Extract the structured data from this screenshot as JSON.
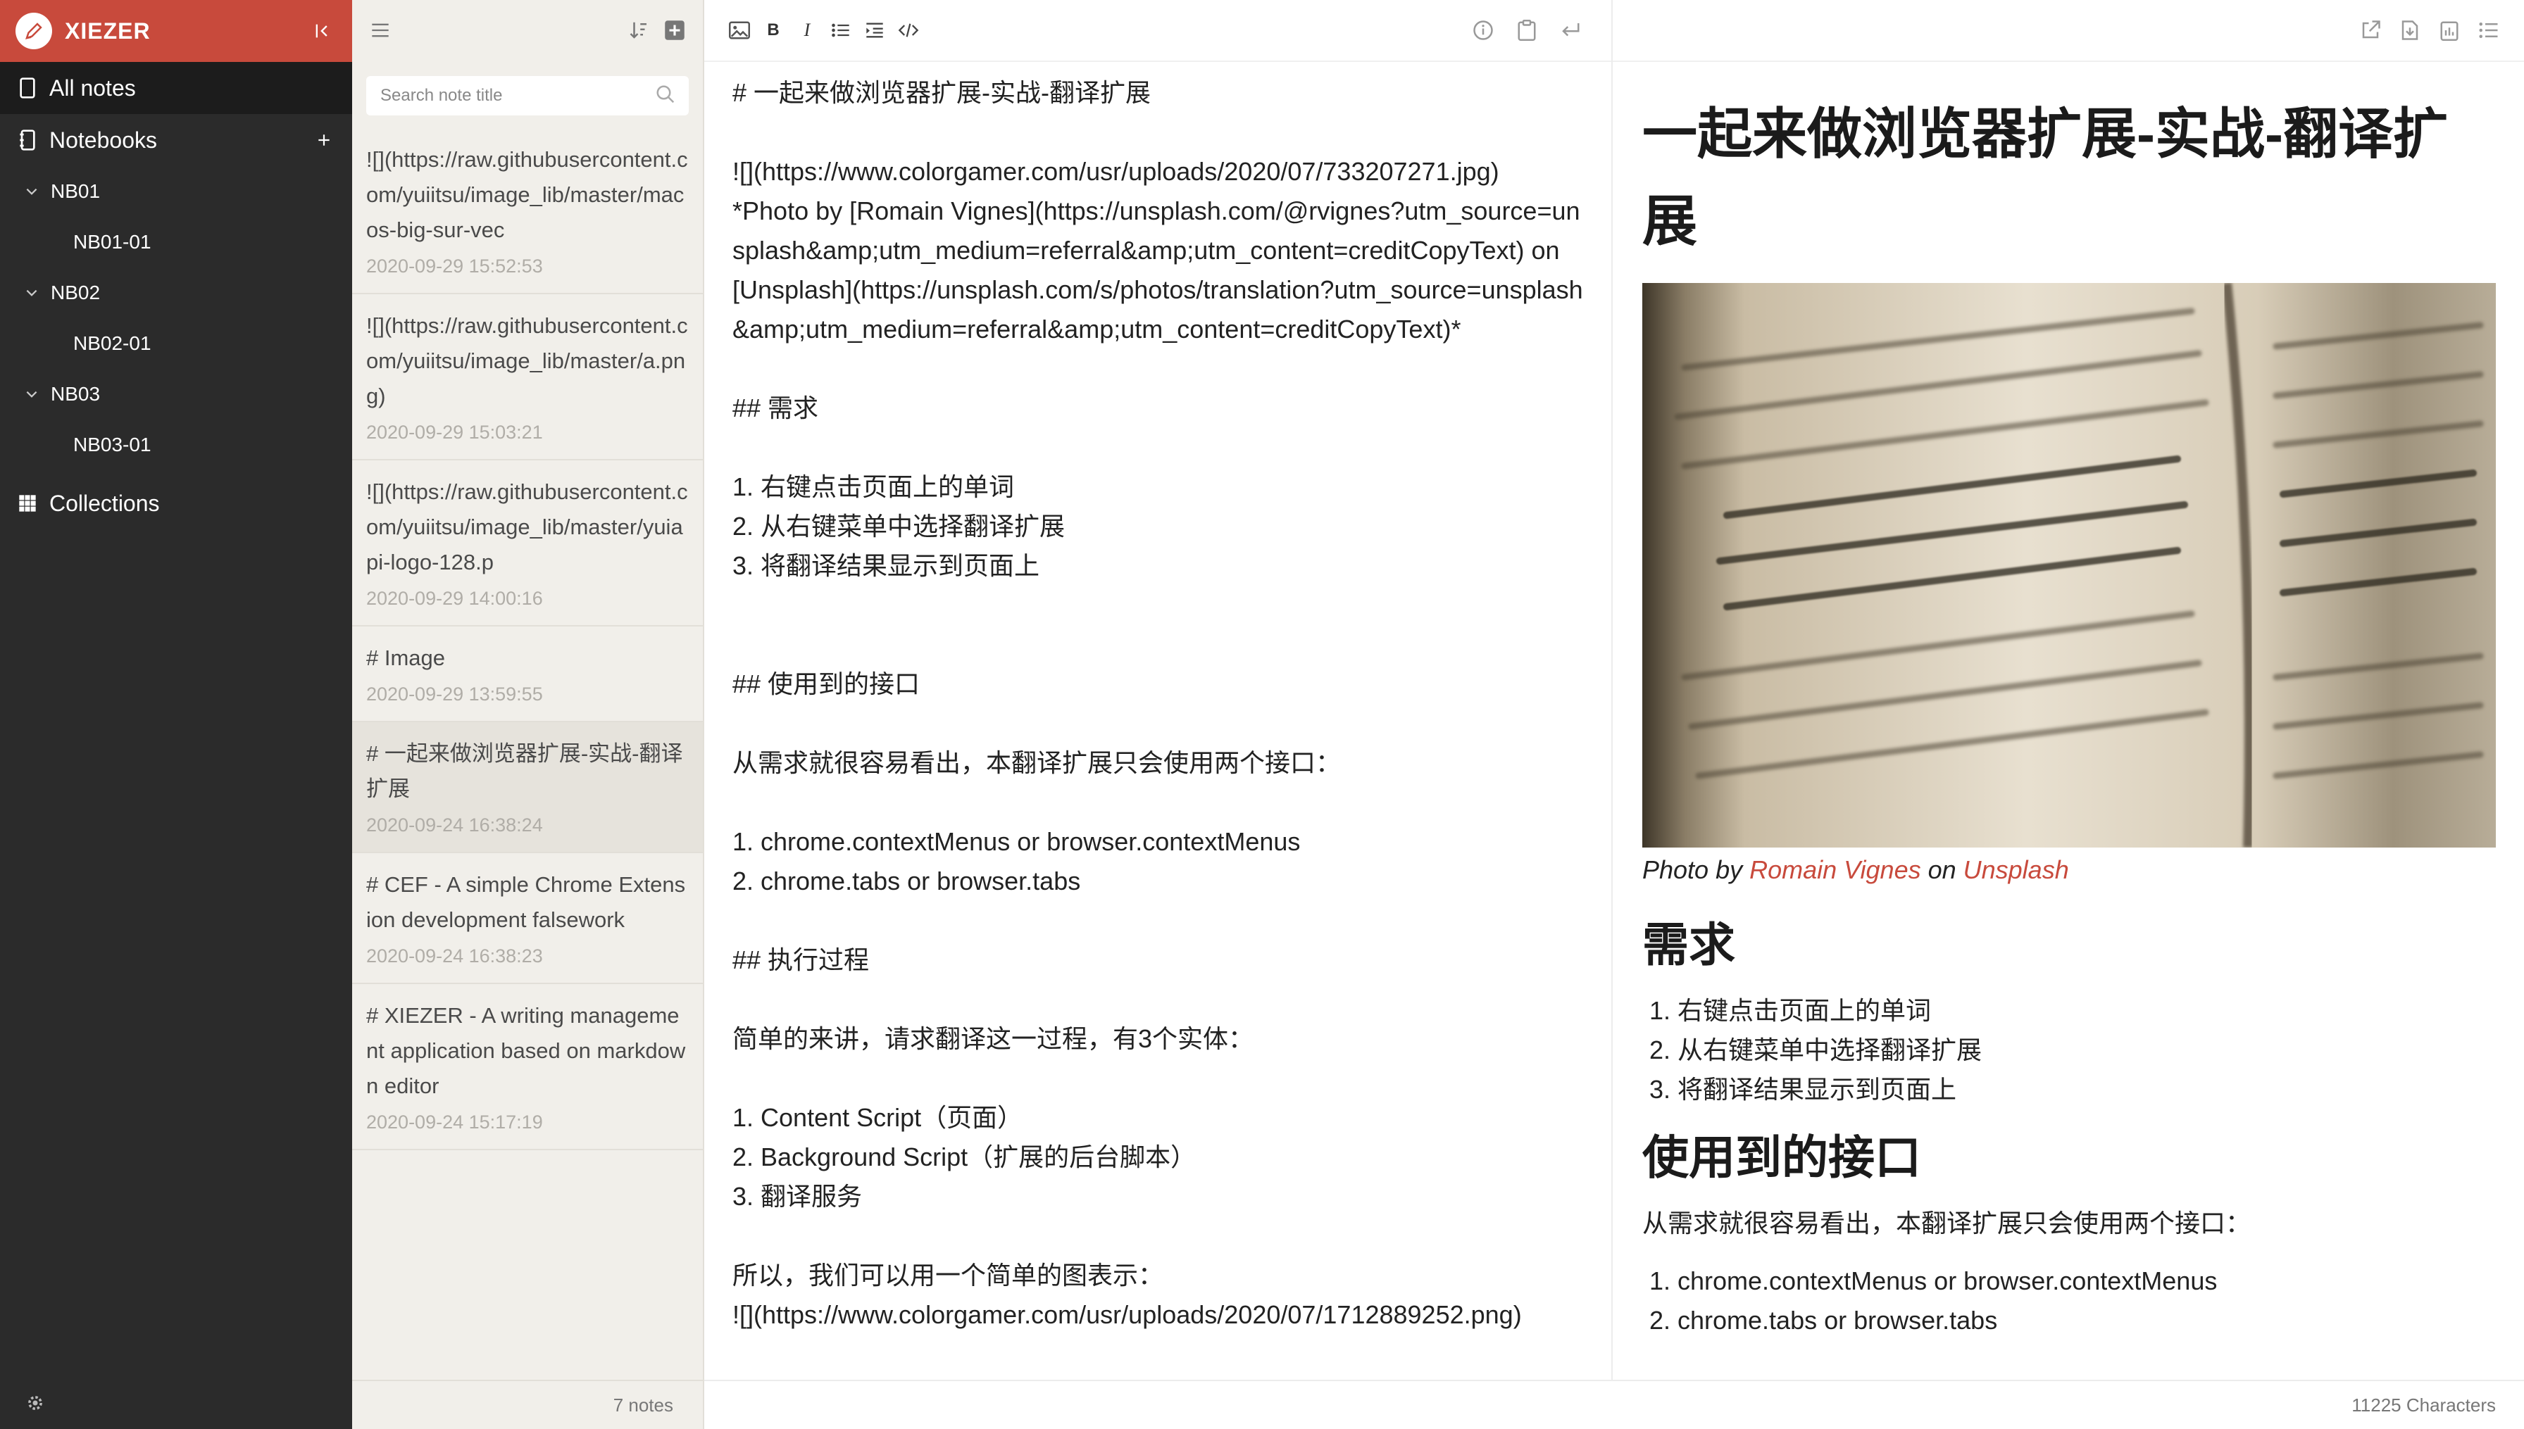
{
  "app": {
    "name": "XIEZER"
  },
  "colors": {
    "brand": "#c84a3c",
    "sidebar_bg": "#2b2b2b",
    "list_bg": "#f1efea",
    "link": "#c84a3c"
  },
  "sidebar": {
    "all_notes": "All notes",
    "notebooks": "Notebooks",
    "tree": [
      {
        "label": "NB01",
        "child": "NB01-01"
      },
      {
        "label": "NB02",
        "child": "NB02-01"
      },
      {
        "label": "NB03",
        "child": "NB03-01"
      }
    ],
    "collections": "Collections"
  },
  "notelist": {
    "search_placeholder": "Search note title",
    "notes": [
      {
        "title": "![](https://raw.githubusercontent.com/yuiitsu/image_lib/master/macos-big-sur-vec",
        "date": "2020-09-29 15:52:53"
      },
      {
        "title": "![](https://raw.githubusercontent.com/yuiitsu/image_lib/master/a.png)",
        "date": "2020-09-29 15:03:21"
      },
      {
        "title": "![](https://raw.githubusercontent.com/yuiitsu/image_lib/master/yuiapi-logo-128.p",
        "date": "2020-09-29 14:00:16"
      },
      {
        "title": "# Image",
        "date": "2020-09-29 13:59:55"
      },
      {
        "title": "# 一起来做浏览器扩展-实战-翻译扩展",
        "date": "2020-09-24 16:38:24"
      },
      {
        "title": "# CEF - A simple Chrome Extension development falsework",
        "date": "2020-09-24 16:38:23"
      },
      {
        "title": "# XIEZER - A writing management application based on markdown editor",
        "date": "2020-09-24 15:17:19"
      }
    ],
    "count": "7 notes"
  },
  "editor": {
    "lines": [
      "# 一起来做浏览器扩展-实战-翻译扩展",
      "",
      "![](https://www.colorgamer.com/usr/uploads/2020/07/733207271.jpg)",
      "*Photo by [Romain Vignes](https://unsplash.com/@rvignes?utm_source=unsplash&amp;utm_medium=referral&amp;utm_content=creditCopyText) on [Unsplash](https://unsplash.com/s/photos/translation?utm_source=unsplash&amp;utm_medium=referral&amp;utm_content=creditCopyText)*",
      "",
      "## 需求",
      "",
      "1. 右键点击页面上的单词",
      "2. 从右键菜单中选择翻译扩展",
      "3. 将翻译结果显示到页面上",
      "",
      "",
      "## 使用到的接口",
      "",
      "从需求就很容易看出，本翻译扩展只会使用两个接口：",
      "",
      "1. chrome.contextMenus or browser.contextMenus",
      "2. chrome.tabs or browser.tabs",
      "",
      "## 执行过程",
      "",
      "简单的来讲，请求翻译这一过程，有3个实体：",
      "",
      "1. Content Script（页面）",
      "2. Background Script（扩展的后台脚本）",
      "3. 翻译服务",
      "",
      "所以，我们可以用一个简单的图表示：",
      "![](https://www.colorgamer.com/usr/uploads/2020/07/1712889252.png)"
    ]
  },
  "preview": {
    "title": "一起来做浏览器扩展-实战-翻译扩展",
    "caption_prefix": "Photo by ",
    "caption_author": "Romain Vignes",
    "caption_mid": " on ",
    "caption_site": "Unsplash",
    "h2_requirements": "需求",
    "requirements": [
      "右键点击页面上的单词",
      "从右键菜单中选择翻译扩展",
      "将翻译结果显示到页面上"
    ],
    "h2_interfaces": "使用到的接口",
    "interfaces_intro": "从需求就很容易看出，本翻译扩展只会使用两个接口：",
    "interfaces": [
      "chrome.contextMenus or browser.contextMenus",
      "chrome.tabs or browser.tabs"
    ]
  },
  "status": {
    "characters": "11225 Characters"
  }
}
